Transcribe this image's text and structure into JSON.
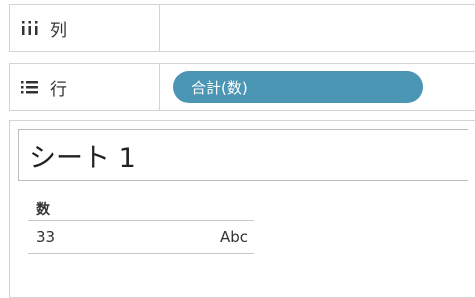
{
  "columns_shelf": {
    "label": "列",
    "icon": "columns-icon"
  },
  "rows_shelf": {
    "label": "行",
    "icon": "rows-icon",
    "pill": "合計(数)",
    "pill_color": "#4a96b4"
  },
  "sheet": {
    "title": "シート 1",
    "table": {
      "header": "数",
      "rows": [
        {
          "value": "33",
          "mark": "Abc"
        }
      ]
    }
  }
}
